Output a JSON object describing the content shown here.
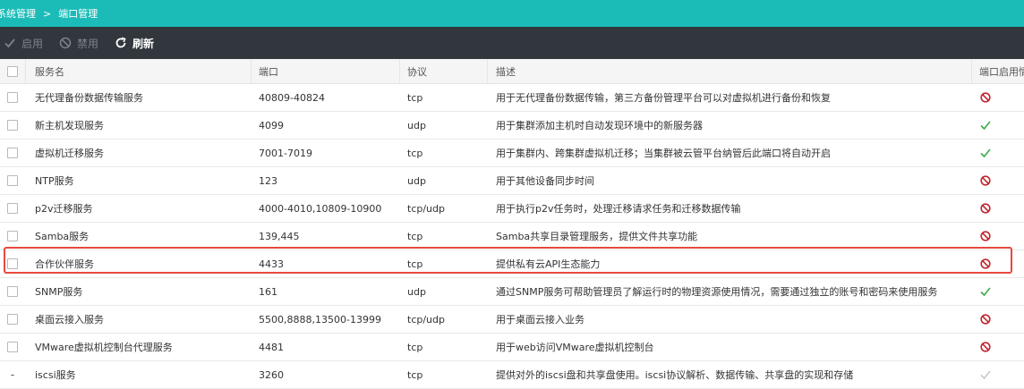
{
  "breadcrumb": {
    "parent": "系统管理",
    "separator": ">",
    "current": "端口管理"
  },
  "toolbar": {
    "enable_label": "启用",
    "disable_label": "禁用",
    "refresh_label": "刷新"
  },
  "table": {
    "columns": {
      "name": "服务名",
      "port": "端口",
      "protocol": "协议",
      "description": "描述",
      "status": "端口启用情"
    },
    "rows": [
      {
        "name": "无代理备份数据传输服务",
        "port": "40809-40824",
        "protocol": "tcp",
        "description": "用于无代理备份数据传输，第三方备份管理平台可以对虚拟机进行备份和恢复",
        "status": "disabled",
        "checkbox": "box"
      },
      {
        "name": "新主机发现服务",
        "port": "4099",
        "protocol": "udp",
        "description": "用于集群添加主机时自动发现环境中的新服务器",
        "status": "enabled",
        "checkbox": "box"
      },
      {
        "name": "虚拟机迁移服务",
        "port": "7001-7019",
        "protocol": "tcp",
        "description": "用于集群内、跨集群虚拟机迁移；当集群被云管平台纳管后此端口将自动开启",
        "status": "enabled",
        "checkbox": "box"
      },
      {
        "name": "NTP服务",
        "port": "123",
        "protocol": "udp",
        "description": "用于其他设备同步时间",
        "status": "disabled",
        "checkbox": "box"
      },
      {
        "name": "p2v迁移服务",
        "port": "4000-4010,10809-10900",
        "protocol": "tcp/udp",
        "description": "用于执行p2v任务时，处理迁移请求任务和迁移数据传输",
        "status": "disabled",
        "checkbox": "box"
      },
      {
        "name": "Samba服务",
        "port": "139,445",
        "protocol": "tcp",
        "description": "Samba共享目录管理服务，提供文件共享功能",
        "status": "disabled",
        "checkbox": "box"
      },
      {
        "name": "合作伙伴服务",
        "port": "4433",
        "protocol": "tcp",
        "description": "提供私有云API生态能力",
        "status": "disabled",
        "checkbox": "box"
      },
      {
        "name": "SNMP服务",
        "port": "161",
        "protocol": "udp",
        "description": "通过SNMP服务可帮助管理员了解运行时的物理资源使用情况，需要通过独立的账号和密码来使用服务",
        "status": "enabled",
        "checkbox": "box"
      },
      {
        "name": "桌面云接入服务",
        "port": "5500,8888,13500-13999",
        "protocol": "tcp/udp",
        "description": "用于桌面云接入业务",
        "status": "disabled",
        "checkbox": "box"
      },
      {
        "name": "VMware虚拟机控制台代理服务",
        "port": "4481",
        "protocol": "tcp",
        "description": "用于web访问VMware虚拟机控制台",
        "status": "disabled",
        "checkbox": "box"
      },
      {
        "name": "iscsi服务",
        "port": "3260",
        "protocol": "tcp",
        "description": "提供对外的iscsi盘和共享盘使用。iscsi协议解析、数据传输、共享盘的实现和存储",
        "status": "enabled-disabled",
        "checkbox": "dash",
        "checkbox_text": "-"
      }
    ]
  },
  "colors": {
    "header_bar": "#1bbcb8",
    "toolbar": "#31373d",
    "enabled_check": "#3cab4a",
    "disabled_icon": "#c0232d",
    "highlight_border": "#e64a3c"
  },
  "icons": {
    "enable": "check-icon",
    "disable": "ban-icon",
    "refresh": "refresh-icon"
  }
}
